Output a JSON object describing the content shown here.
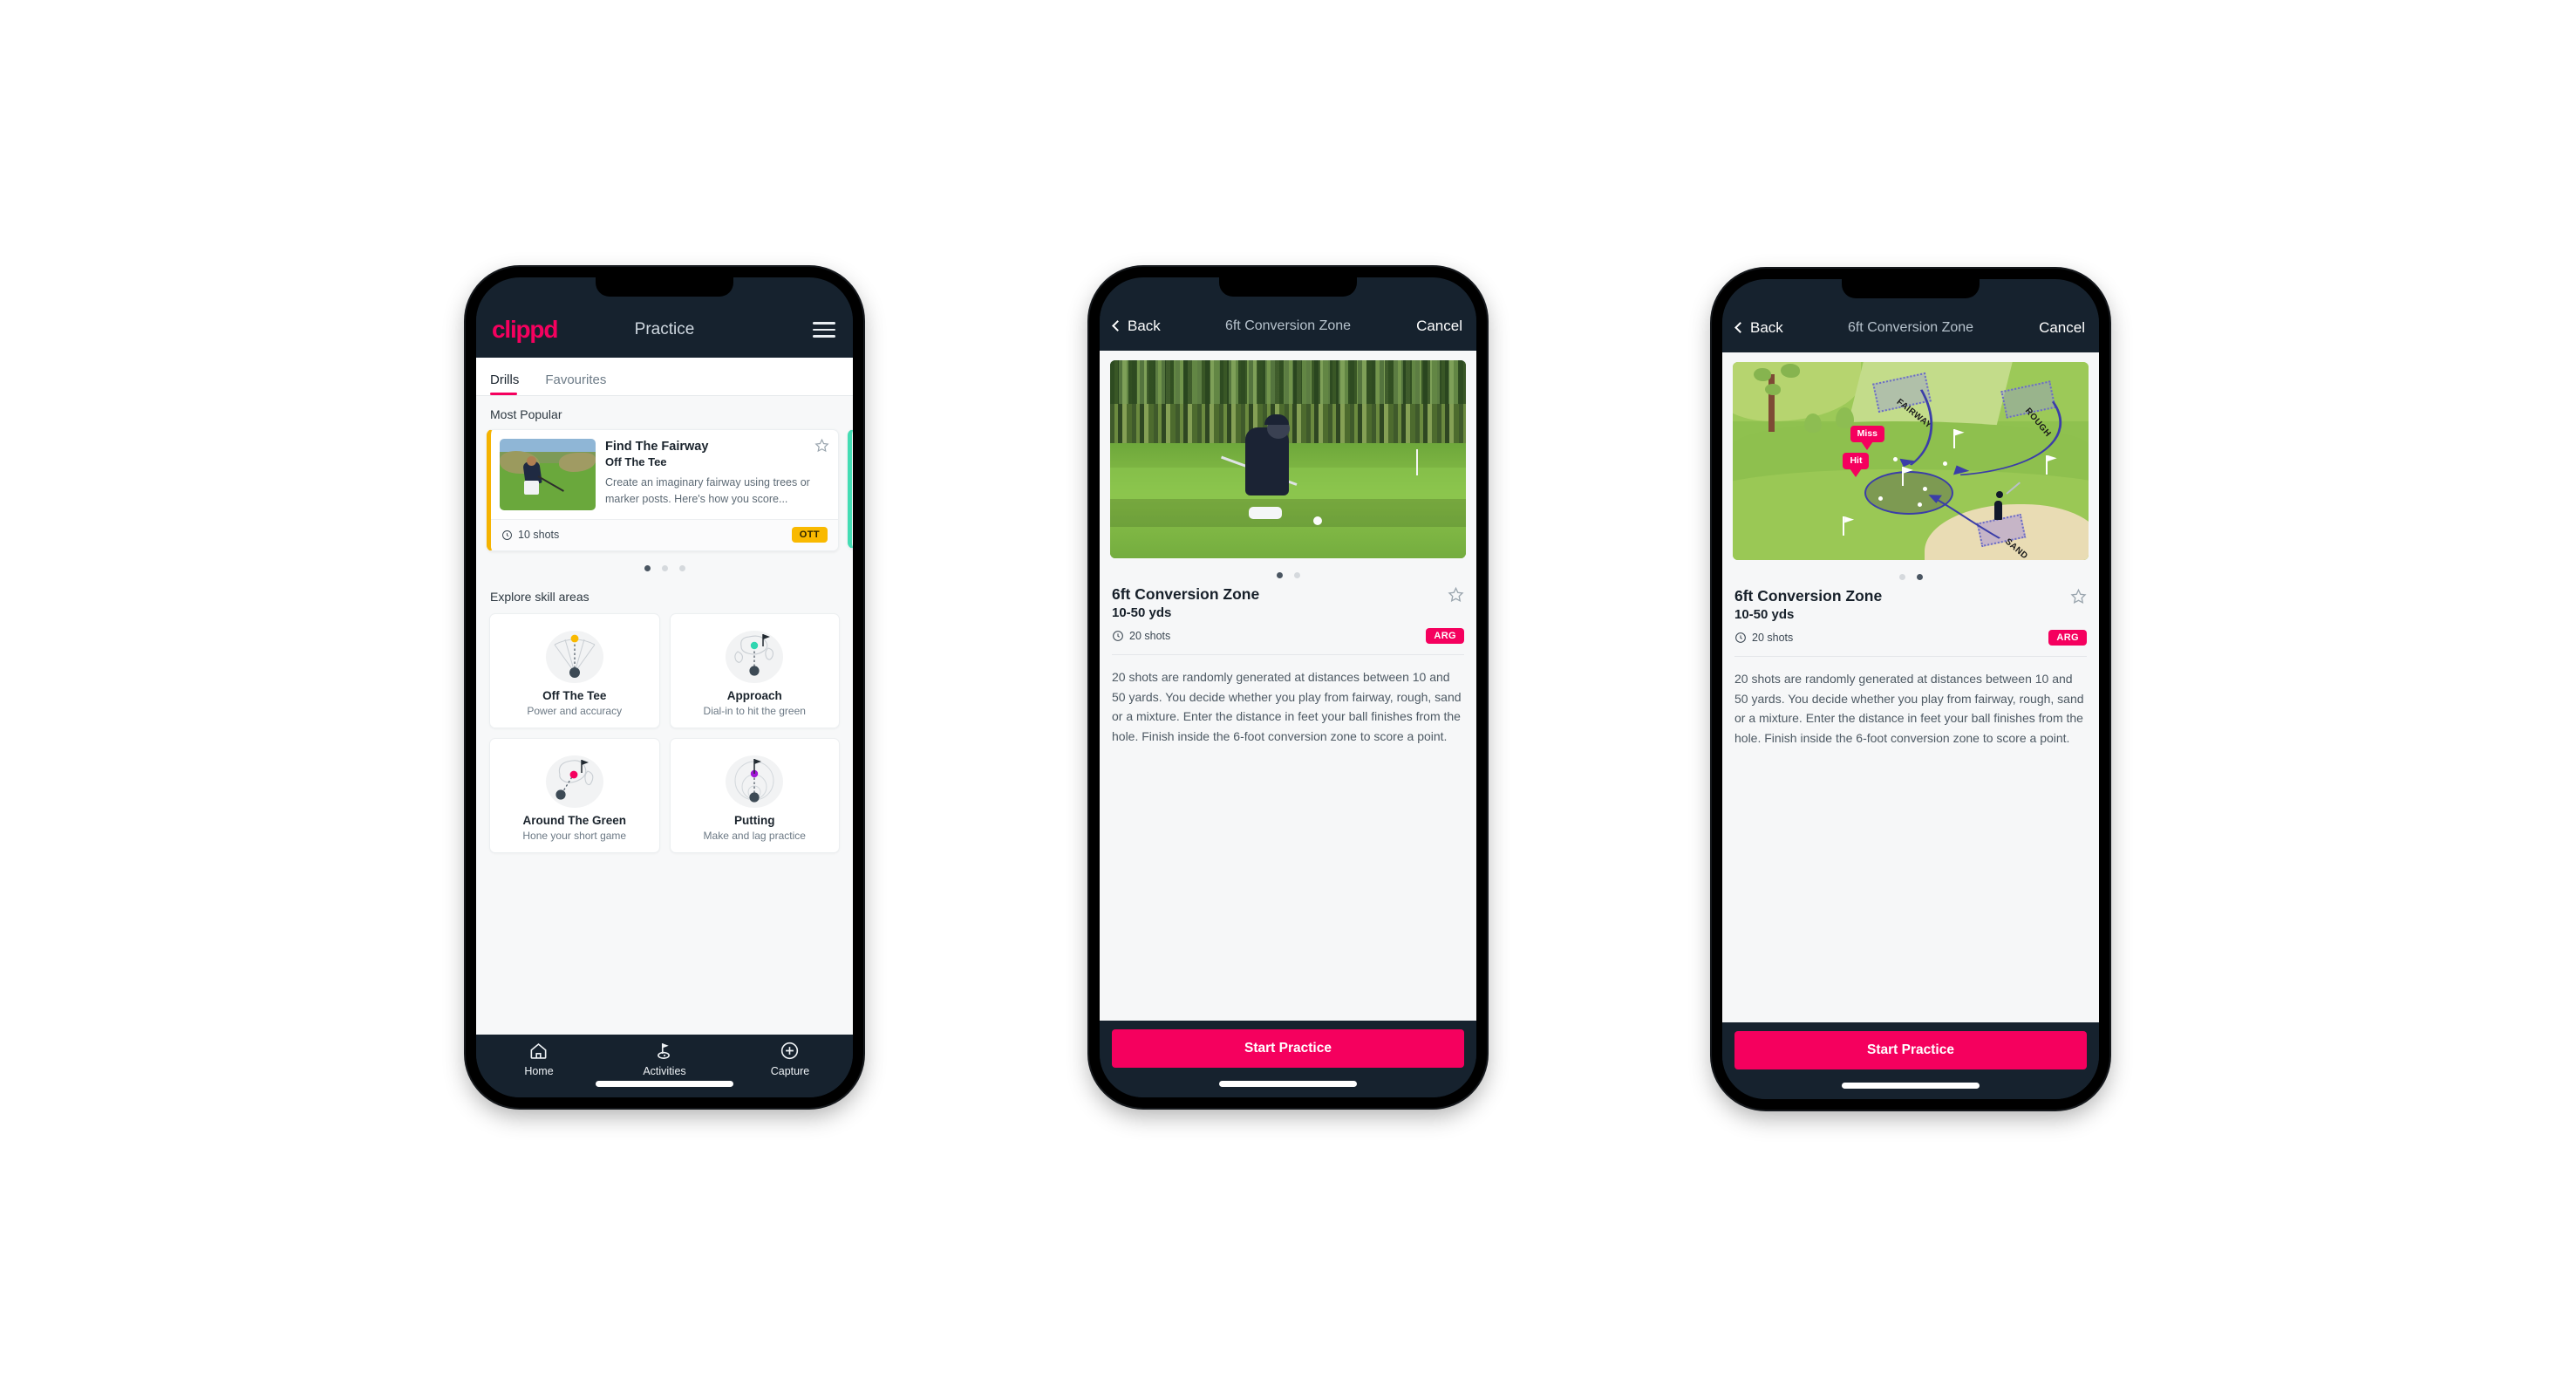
{
  "app": {
    "brand": "clippd",
    "accent_pink": "#f5005e",
    "dark_navy": "#16222e",
    "badge_yellow": "#f9b900",
    "badge_teal": "#44ddb4"
  },
  "phone1": {
    "header": {
      "title": "Practice",
      "menu_icon": "hamburger-icon"
    },
    "tabs": [
      {
        "label": "Drills",
        "active": true
      },
      {
        "label": "Favourites",
        "active": false
      }
    ],
    "most_popular": {
      "section_label": "Most Popular",
      "card": {
        "title": "Find The Fairway",
        "subtitle": "Off The Tee",
        "description": "Create an imaginary fairway using trees or marker posts. Here's how you score...",
        "shots": "10 shots",
        "badge": "OTT",
        "badge_color": "#f9b900",
        "accent_color": "#f5b301",
        "favourite_icon": "star-outline-icon",
        "shots_icon": "clock-icon"
      },
      "next_card_accent": "#44ddb4",
      "pagination": {
        "count": 3,
        "active_index": 0
      }
    },
    "skill_areas": {
      "section_label": "Explore skill areas",
      "items": [
        {
          "name": "Off The Tee",
          "desc": "Power and accuracy",
          "icon": "tee-fan-icon",
          "dot_color": "#f9b900"
        },
        {
          "name": "Approach",
          "desc": "Dial-in to hit the green",
          "icon": "approach-green-icon",
          "dot_color": "#2fd6b0"
        },
        {
          "name": "Around The Green",
          "desc": "Hone your short game",
          "icon": "chip-green-icon",
          "dot_color": "#f5005e"
        },
        {
          "name": "Putting",
          "desc": "Make and lag practice",
          "icon": "putting-rings-icon",
          "dot_color": "#a216d6"
        }
      ]
    },
    "bottom_nav": [
      {
        "label": "Home",
        "icon": "home-icon",
        "active": false
      },
      {
        "label": "Activities",
        "icon": "golf-flag-icon",
        "active": true
      },
      {
        "label": "Capture",
        "icon": "plus-circle-icon",
        "active": false
      }
    ]
  },
  "phone2": {
    "header": {
      "back": "Back",
      "title": "6ft Conversion Zone",
      "cancel": "Cancel"
    },
    "hero": {
      "type": "photo",
      "alt": "golfer chipping on a course with pine trees"
    },
    "pagination": {
      "count": 2,
      "active_index": 0
    },
    "drill": {
      "name": "6ft Conversion Zone",
      "distance": "10-50 yds",
      "shots": "20 shots",
      "badge": "ARG",
      "badge_color": "#f5005e",
      "favourite_icon": "star-outline-icon",
      "shots_icon": "clock-icon",
      "description": "20 shots are randomly generated at distances between 10 and 50 yards. You decide whether you play from fairway, rough, sand or a mixture. Enter the distance in feet your ball finishes from the hole. Finish inside the 6-foot conversion zone to score a point."
    },
    "cta": "Start Practice"
  },
  "phone3": {
    "header": {
      "back": "Back",
      "title": "6ft Conversion Zone",
      "cancel": "Cancel"
    },
    "hero": {
      "type": "illustration",
      "alt": "isometric golf hole diagram showing lie zones and shot paths",
      "zone_labels": [
        "FAIRWAY",
        "ROUGH",
        "SAND"
      ],
      "callouts": [
        "Miss",
        "Hit"
      ]
    },
    "pagination": {
      "count": 2,
      "active_index": 1
    },
    "drill": {
      "name": "6ft Conversion Zone",
      "distance": "10-50 yds",
      "shots": "20 shots",
      "badge": "ARG",
      "badge_color": "#f5005e",
      "favourite_icon": "star-outline-icon",
      "shots_icon": "clock-icon",
      "description": "20 shots are randomly generated at distances between 10 and 50 yards. You decide whether you play from fairway, rough, sand or a mixture. Enter the distance in feet your ball finishes from the hole. Finish inside the 6-foot conversion zone to score a point."
    },
    "cta": "Start Practice"
  }
}
